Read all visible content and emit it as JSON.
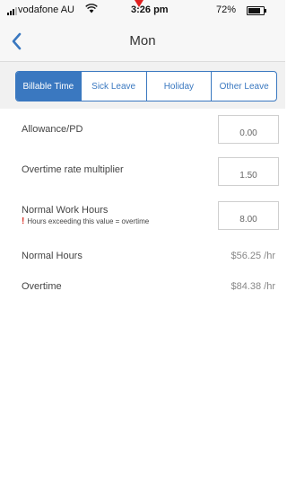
{
  "status_bar": {
    "carrier": "vodafone AU",
    "time": "3:26 pm",
    "battery": "72%"
  },
  "nav": {
    "title": "Mon"
  },
  "tabs": [
    {
      "label": "Billable Time",
      "active": true
    },
    {
      "label": "Sick Leave",
      "active": false
    },
    {
      "label": "Holiday",
      "active": false
    },
    {
      "label": "Other Leave",
      "active": false
    }
  ],
  "fields": {
    "allowance": {
      "label": "Allowance/PD",
      "value": "0.00"
    },
    "overtime_rate": {
      "label": "Overtime rate multiplier",
      "value": "1.50"
    },
    "normal_work_hours": {
      "label": "Normal Work Hours",
      "hint": "Hours exceeding this value = overtime",
      "value": "8.00"
    }
  },
  "rates": {
    "normal_hours": {
      "label": "Normal Hours",
      "value": "$56.25 /hr"
    },
    "overtime": {
      "label": "Overtime",
      "value": "$84.38 /hr"
    }
  },
  "colors": {
    "accent": "#3a78c0",
    "warning": "#d93025"
  }
}
